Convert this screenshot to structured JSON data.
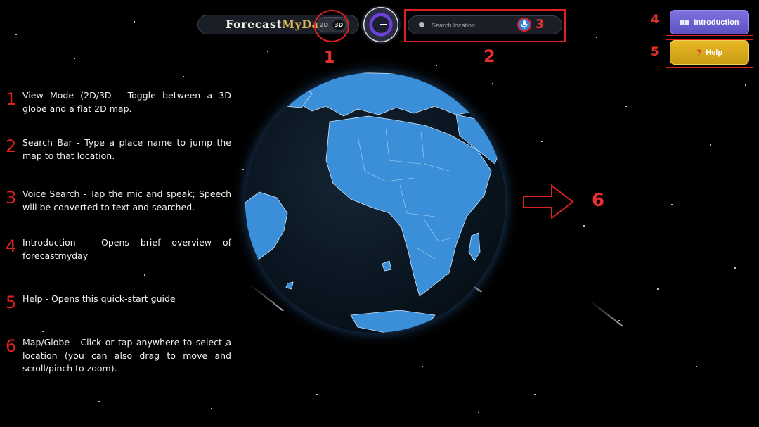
{
  "brand": {
    "part1": "Forecast",
    "part2": "MyDay"
  },
  "mode_toggle": {
    "options": [
      "2D",
      "3D"
    ],
    "active": "3D"
  },
  "search": {
    "placeholder": "Search location",
    "value": ""
  },
  "buttons": {
    "introduction": {
      "label": "Introduction",
      "icon": "book-icon"
    },
    "help": {
      "label": "Help",
      "icon": "question-icon"
    }
  },
  "callouts": {
    "c1": "1",
    "c2": "2",
    "c3": "3",
    "c4": "4",
    "c5": "5",
    "c6": "6"
  },
  "guide": {
    "items": [
      {
        "num": "1",
        "text": "View Mode (2D/3D - Toggle between a 3D globe and a flat 2D map."
      },
      {
        "num": "2",
        "text": "Search Bar - Type a place name to jump the map to that location."
      },
      {
        "num": "3",
        "text": "Voice Search - Tap the mic and speak; Speech will be converted to text and searched."
      },
      {
        "num": "4",
        "text": "Introduction - Opens brief overview of forecastmyday"
      },
      {
        "num": "5",
        "text": "Help - Opens this quick-start guide"
      },
      {
        "num": "6",
        "text": "Map/Globe - Click or tap anywhere to select a location (you can also drag to move and scroll/pinch to zoom)."
      }
    ]
  },
  "colors": {
    "callout_red": "#e02020",
    "intro_purple": "#6d62d4",
    "help_gold": "#d8aa1d",
    "globe_blue": "#3b8fd9",
    "brand_gold": "#d8b65a"
  }
}
